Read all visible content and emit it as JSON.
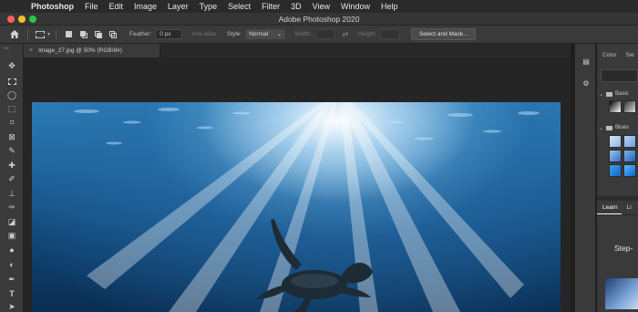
{
  "menubar": {
    "apple_icon": "apple-icon",
    "app_name": "Photoshop",
    "items": [
      "File",
      "Edit",
      "Image",
      "Layer",
      "Type",
      "Select",
      "Filter",
      "3D",
      "View",
      "Window",
      "Help"
    ]
  },
  "window": {
    "title": "Adobe Photoshop 2020"
  },
  "options_bar": {
    "feather_label": "Feather:",
    "feather_value": "0 px",
    "antialias_label": "Anti-alias",
    "style_label": "Style:",
    "style_value": "Normal",
    "width_label": "Width:",
    "height_label": "Height:",
    "select_mask_label": "Select and Mask..."
  },
  "document": {
    "tab_label": "Image_27.jpg @ 50% (RGB/8#)",
    "close_icon": "close-icon"
  },
  "tools": [
    "move-tool-icon",
    "rectangular-marquee-icon",
    "lasso-icon",
    "object-selection-icon",
    "crop-icon",
    "frame-icon",
    "eyedropper-icon",
    "healing-brush-icon",
    "brush-icon",
    "clone-stamp-icon",
    "history-brush-icon",
    "eraser-icon",
    "gradient-icon",
    "blur-icon",
    "dodge-icon",
    "pen-icon",
    "type-icon",
    "path-selection-icon"
  ],
  "right_panel": {
    "tabs": [
      "Color",
      "Sw"
    ],
    "groups": [
      "Basic",
      "Blues"
    ],
    "learn_tabs": [
      "Learn",
      "Li"
    ],
    "learn_heading": "Step-"
  },
  "colors": {
    "menubar_bg": "#2a2a2a",
    "panel_bg": "#3a3a3a",
    "canvas_bg": "#252525",
    "water_deep": "#0a2d52",
    "water_light": "#2d7fb9"
  }
}
